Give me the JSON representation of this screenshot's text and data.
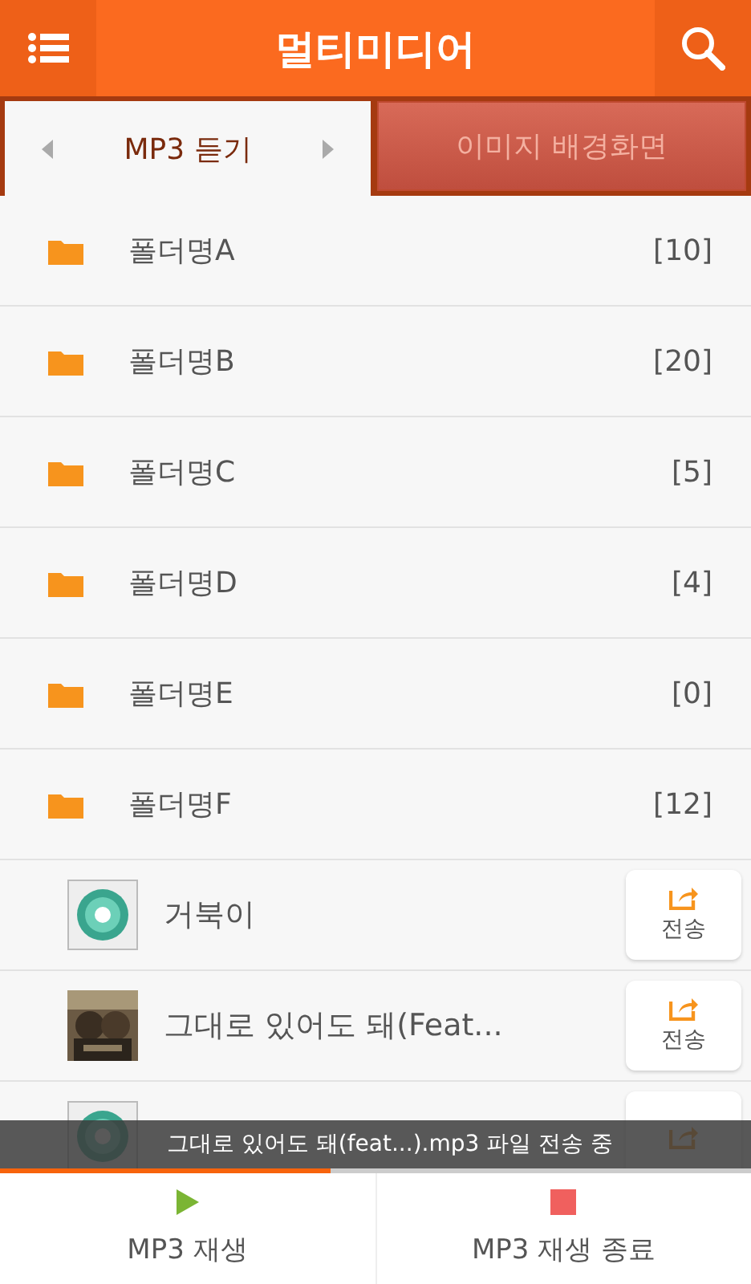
{
  "header": {
    "title": "멀티미디어"
  },
  "tabs": [
    {
      "label": "MP3 듣기",
      "selected": true
    },
    {
      "label": "이미지 배경화면",
      "selected": false
    }
  ],
  "folders": [
    {
      "name": "폴더명A",
      "count": "[10]"
    },
    {
      "name": "폴더명B",
      "count": "[20]"
    },
    {
      "name": "폴더명C",
      "count": "[5]"
    },
    {
      "name": "폴더명D",
      "count": "[4]"
    },
    {
      "name": "폴더명E",
      "count": "[0]"
    },
    {
      "name": "폴더명F",
      "count": "[12]"
    }
  ],
  "songs": [
    {
      "kind": "cd",
      "title": "거북이",
      "send": "전송"
    },
    {
      "kind": "picture",
      "title": "그대로 있어도 돼(Feat...",
      "send": "전송"
    },
    {
      "kind": "cd"
    }
  ],
  "toast": {
    "text": "그대로 있어도 돼(feat...).mp3 파일 전송 중"
  },
  "transfer": {
    "level": 0.44
  },
  "bottom": [
    {
      "kind": "play",
      "label": "MP3 재생"
    },
    {
      "kind": "stop",
      "label": "MP3 재생 종료"
    }
  ]
}
